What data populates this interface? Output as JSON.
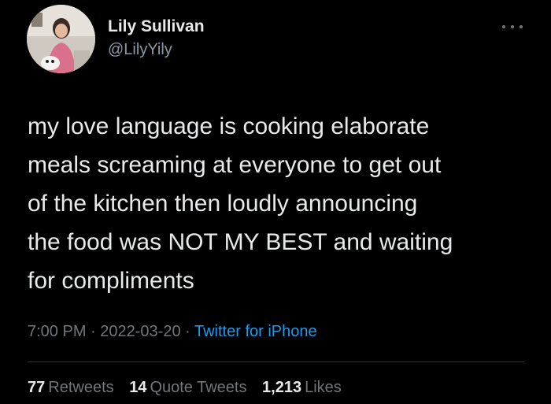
{
  "user": {
    "name": "Lily Sullivan",
    "handle": "@LilyYily"
  },
  "tweet": {
    "lines": [
      "my love language is cooking elaborate",
      "meals screaming at everyone to get out",
      "of the kitchen then loudly announcing",
      "the food was NOT MY BEST and waiting",
      "for compliments"
    ],
    "time": "7:00 PM",
    "date": "2022-03-20",
    "separator": " · ",
    "source": "Twitter for iPhone"
  },
  "stats": {
    "retweets_count": "77",
    "retweets_label": "Retweets",
    "quotes_count": "14",
    "quotes_label": "Quote Tweets",
    "likes_count": "1,213",
    "likes_label": "Likes"
  },
  "icons": {
    "more": "more-horizontal-icon"
  },
  "colors": {
    "background": "#000000",
    "text": "#e7e9ea",
    "muted": "#71767b",
    "link": "#1d9bf0",
    "divider": "#2f3336"
  }
}
